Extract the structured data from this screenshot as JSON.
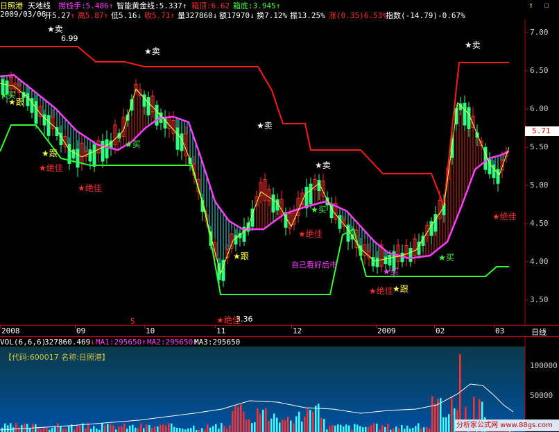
{
  "header": {
    "stock_name": "日照港",
    "indicator": "天地线",
    "values": [
      {
        "label": "捞钱手",
        "sep": ":",
        "value": "5.486",
        "arrow": "↑",
        "color": "#ff40ff"
      },
      {
        "label": "智能黄金线",
        "sep": ":",
        "value": "5.337",
        "arrow": "↑",
        "color": "#ffffff"
      },
      {
        "label": "箱顶",
        "sep": ":",
        "value": "6.62",
        "arrow": "",
        "color": "#ff3030"
      },
      {
        "label": "箱底",
        "sep": ":",
        "value": "3.945",
        "arrow": "↑",
        "color": "#40ff40"
      }
    ],
    "icons": [
      "up-arrow-icon",
      "box-icon"
    ]
  },
  "infobar": {
    "date": "2009/03/06",
    "open": "开5.27",
    "open_arrow": "↑",
    "high": "高5.87",
    "high_arrow": "↑",
    "low": "低5.16",
    "low_arrow": "↓",
    "close": "收5.71",
    "close_arrow": "↑",
    "volume": "量327860",
    "volume_arrow": "↓",
    "amount": "额17970",
    "amount_arrow": "↓",
    "turnover": "换7.12%",
    "amplitude": "振13.25%",
    "change": "涨(0.35)6.53%",
    "index": "指数(-14.79)-0.67%"
  },
  "price_axis": {
    "ticks": [
      "7.00",
      "6.50",
      "6.00",
      "5.50",
      "5.00",
      "4.50",
      "4.00",
      "3.50"
    ],
    "current_price": "5.71"
  },
  "date_axis": {
    "ticks": [
      "2008",
      "09",
      "10",
      "11",
      "12",
      "2009",
      "02",
      "03"
    ],
    "period_label": "日线",
    "marker": "S"
  },
  "annotations": {
    "high_price": "6.99",
    "low_price": "3.36",
    "note": "自己看好后市"
  },
  "signals": {
    "sell": "★卖",
    "buy": "★买",
    "follow": "★跟",
    "best": "★绝佳"
  },
  "volume": {
    "header_label": "VOL(6,6,6)",
    "value": "327860.469",
    "value_arrow": "↓",
    "ma1": "MA1:295650",
    "ma1_arrow": "↑",
    "ma2": "MA2:295650",
    "ma2_arrow": "↑",
    "ma3": "MA3:295650",
    "code_label": "【代码:600017 名称:日照港】",
    "ticks": [
      "100000",
      "50000"
    ]
  },
  "watermark": "分析家公式网 www.88gs.com",
  "colors": {
    "up": "#ff3030",
    "down": "#40ffff",
    "golden": "#ffff40",
    "magenta": "#ff40ff",
    "box_top": "#ff2020",
    "box_bottom": "#30ff30"
  }
}
